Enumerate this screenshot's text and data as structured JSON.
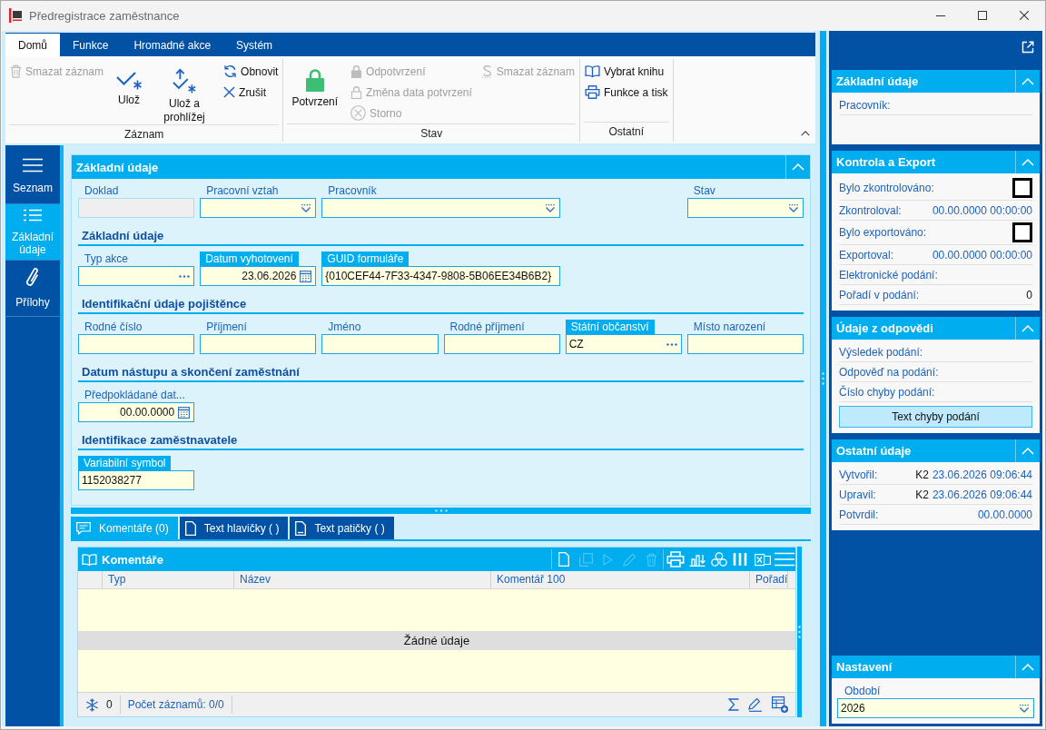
{
  "window": {
    "title": "Předregistrace zaměstnance"
  },
  "ribbon": {
    "tabs": [
      {
        "label": "Domů",
        "selected": true
      },
      {
        "label": "Funkce",
        "selected": false
      },
      {
        "label": "Hromadné akce",
        "selected": false
      },
      {
        "label": "Systém",
        "selected": false
      }
    ],
    "groups": [
      {
        "label": "Záznam",
        "columns": [
          [
            {
              "label": "Smazat záznam",
              "kind": "small",
              "disabled": true
            }
          ],
          [
            {
              "label": "Ulož",
              "kind": "large",
              "disabled": false
            }
          ],
          [
            {
              "label": "Ulož a prohlížej",
              "kind": "large",
              "disabled": false
            }
          ],
          [
            {
              "label": "Obnovit",
              "kind": "small",
              "disabled": false
            },
            {
              "label": "Zrušit",
              "kind": "small",
              "disabled": false
            }
          ]
        ]
      },
      {
        "label": "Stav",
        "columns": [
          [
            {
              "label": "Potvrzení",
              "kind": "large",
              "disabled": false
            }
          ],
          [
            {
              "label": "Odpotvrzení",
              "kind": "small",
              "disabled": true
            },
            {
              "label": "Změna data potvrzení",
              "kind": "small",
              "disabled": true
            },
            {
              "label": "Storno",
              "kind": "small",
              "disabled": true
            }
          ],
          [
            {
              "label": "Smazat záznam",
              "kind": "small",
              "disabled": true
            }
          ]
        ]
      },
      {
        "label": "Ostatní",
        "columns": [
          [
            {
              "label": "Vybrat knihu",
              "kind": "small",
              "disabled": false
            },
            {
              "label": "Funkce a tisk",
              "kind": "small",
              "disabled": false
            }
          ]
        ]
      }
    ]
  },
  "navigation": [
    {
      "label": "Seznam",
      "selected": false
    },
    {
      "label": "Základní údaje",
      "selected": true
    },
    {
      "label": "Přílohy",
      "selected": false
    }
  ],
  "form": {
    "title": "Základní údaje",
    "sections": [
      {
        "fields": [
          {
            "label": "Doklad",
            "kind": "text",
            "disabled": true,
            "highlighted": false
          },
          {
            "label": "Pracovní vztah",
            "kind": "dropdown",
            "disabled": false,
            "highlighted": false
          },
          {
            "label": "Pracovník",
            "kind": "dropdown",
            "disabled": false,
            "highlighted": false
          },
          {
            "label": "Stav",
            "kind": "dropdown",
            "disabled": false,
            "highlighted": false
          }
        ]
      },
      {
        "heading": "Základní údaje",
        "fields": [
          {
            "label": "Typ akce",
            "kind": "lookup",
            "disabled": false,
            "highlighted": false
          },
          {
            "label": "Datum vyhotovení",
            "kind": "date",
            "value": "23.06.2026",
            "disabled": false,
            "highlighted": true
          },
          {
            "label": "GUID formuláře",
            "kind": "text",
            "value": "{010CEF44-7F33-4347-9808-5B06EE34B6B2}",
            "disabled": false,
            "highlighted": true
          }
        ]
      },
      {
        "heading": "Identifikační údaje pojištěnce",
        "fields": [
          {
            "label": "Rodné číslo",
            "kind": "text",
            "disabled": false,
            "highlighted": false
          },
          {
            "label": "Příjmení",
            "kind": "text",
            "disabled": false,
            "highlighted": false
          },
          {
            "label": "Jméno",
            "kind": "text",
            "disabled": false,
            "highlighted": false
          },
          {
            "label": "Rodné příjmení",
            "kind": "text",
            "disabled": false,
            "highlighted": false
          },
          {
            "label": "Státní občanství",
            "kind": "lookup",
            "value": "CZ",
            "disabled": false,
            "highlighted": true
          },
          {
            "label": "Místo narození",
            "kind": "text",
            "disabled": false,
            "highlighted": false
          }
        ]
      },
      {
        "heading": "Datum nástupu a skončení zaměstnání",
        "fields": [
          {
            "label": "Předpokládané dat...",
            "kind": "date",
            "value": "00.00.0000",
            "disabled": false,
            "highlighted": false
          }
        ]
      },
      {
        "heading": "Identifikace zaměstnavatele",
        "fields": [
          {
            "label": "Variabilní symbol",
            "kind": "text",
            "value": "1152038277",
            "disabled": false,
            "highlighted": true
          }
        ]
      }
    ]
  },
  "detail_tabs": [
    {
      "label": "Komentáře (0)",
      "selected": true
    },
    {
      "label": "Text hlavičky ( )",
      "selected": false
    },
    {
      "label": "Text patičky ( )",
      "selected": false
    }
  ],
  "comments": {
    "title": "Komentáře",
    "toolbar": [
      {
        "disabled": false
      },
      {
        "disabled": true
      },
      {
        "disabled": true
      },
      {
        "disabled": true
      },
      {
        "disabled": true
      },
      {
        "disabled": false
      },
      {
        "disabled": false
      },
      {
        "disabled": false
      },
      {
        "disabled": false
      },
      {
        "disabled": false
      },
      {
        "disabled": false
      }
    ],
    "columns": [
      "Typ",
      "Název",
      "Komentář 100",
      "Pořadí"
    ],
    "empty_text": "Žádné údaje",
    "footer": {
      "count": "0",
      "records": "Počet záznamů: 0/0"
    }
  },
  "side_panel": {
    "cards": [
      {
        "title": "Základní údaje",
        "rows": [
          {
            "kind": "field",
            "label": "Pracovník:"
          }
        ]
      },
      {
        "title": "Kontrola a Export",
        "rows": [
          {
            "kind": "checkbox",
            "label": "Bylo zkontrolováno:",
            "checked": false
          },
          {
            "kind": "field",
            "label": "Zkontroloval:",
            "value": "00.00.0000 00:00:00"
          },
          {
            "kind": "checkbox",
            "label": "Bylo exportováno:",
            "checked": false
          },
          {
            "kind": "field",
            "label": "Exportoval:",
            "value": "00.00.0000 00:00:00"
          },
          {
            "kind": "field",
            "label": "Elektronické podání:"
          },
          {
            "kind": "number",
            "label": "Pořadí v podání:",
            "value": "0"
          }
        ]
      },
      {
        "title": "Údaje z odpovědi",
        "rows": [
          {
            "kind": "field",
            "label": "Výsledek podání:"
          },
          {
            "kind": "field",
            "label": "Odpověď na podání:"
          },
          {
            "kind": "field",
            "label": "Číslo chyby podání:"
          },
          {
            "kind": "button",
            "label": "Text chyby podání"
          }
        ]
      },
      {
        "title": "Ostatní údaje",
        "rows": [
          {
            "kind": "field",
            "label": "Vytvořil:",
            "user": "K2",
            "value": "23.06.2026 09:06:44"
          },
          {
            "kind": "field",
            "label": "Upravil:",
            "user": "K2",
            "value": "23.06.2026 09:06:44"
          },
          {
            "kind": "field",
            "label": "Potvrdil:",
            "value": "00.00.0000"
          }
        ]
      }
    ],
    "settings": {
      "title": "Nastavení",
      "fields": [
        {
          "label": "Období",
          "kind": "dropdown",
          "value": "2026"
        }
      ]
    }
  }
}
